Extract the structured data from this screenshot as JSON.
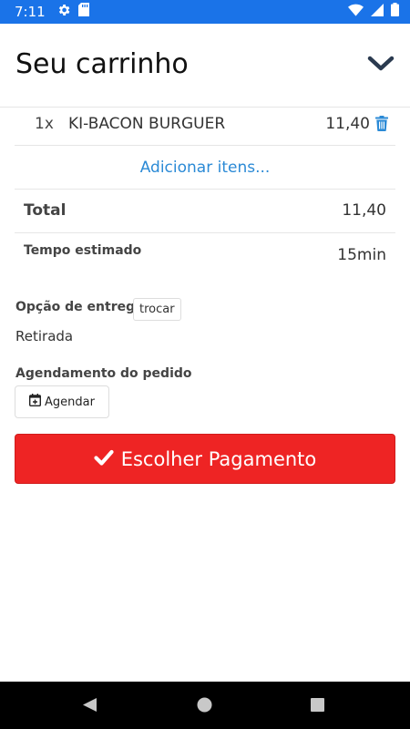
{
  "status_bar": {
    "time": "7:11",
    "icons_left": [
      "gear-icon",
      "sd-card-icon"
    ],
    "icons_right": [
      "wifi-icon",
      "signal-icon",
      "battery-icon"
    ],
    "background_color": "#1a73e8"
  },
  "header": {
    "title": "Seu carrinho",
    "collapse_icon": "chevron-down-icon"
  },
  "cart": {
    "items": [
      {
        "quantity": "1x",
        "name": "KI-BACON BURGUER",
        "price": "11,40",
        "remove_icon": "trash-icon"
      }
    ],
    "add_items_label": "Adicionar itens..."
  },
  "summary": {
    "total_label": "Total",
    "total_value": "11,40",
    "time_label": "Tempo estimado",
    "time_value": "15min"
  },
  "delivery": {
    "label": "Opção de entrega",
    "swap_label": "trocar",
    "value": "Retirada"
  },
  "schedule": {
    "label": "Agendamento do pedido",
    "button_label": "Agendar",
    "button_icon": "calendar-plus-icon"
  },
  "payment": {
    "button_label": "Escolher Pagamento",
    "button_icon": "check-icon",
    "button_color": "#ee2424"
  },
  "colors": {
    "link": "#2b8ad6",
    "accent": "#ee2424"
  }
}
